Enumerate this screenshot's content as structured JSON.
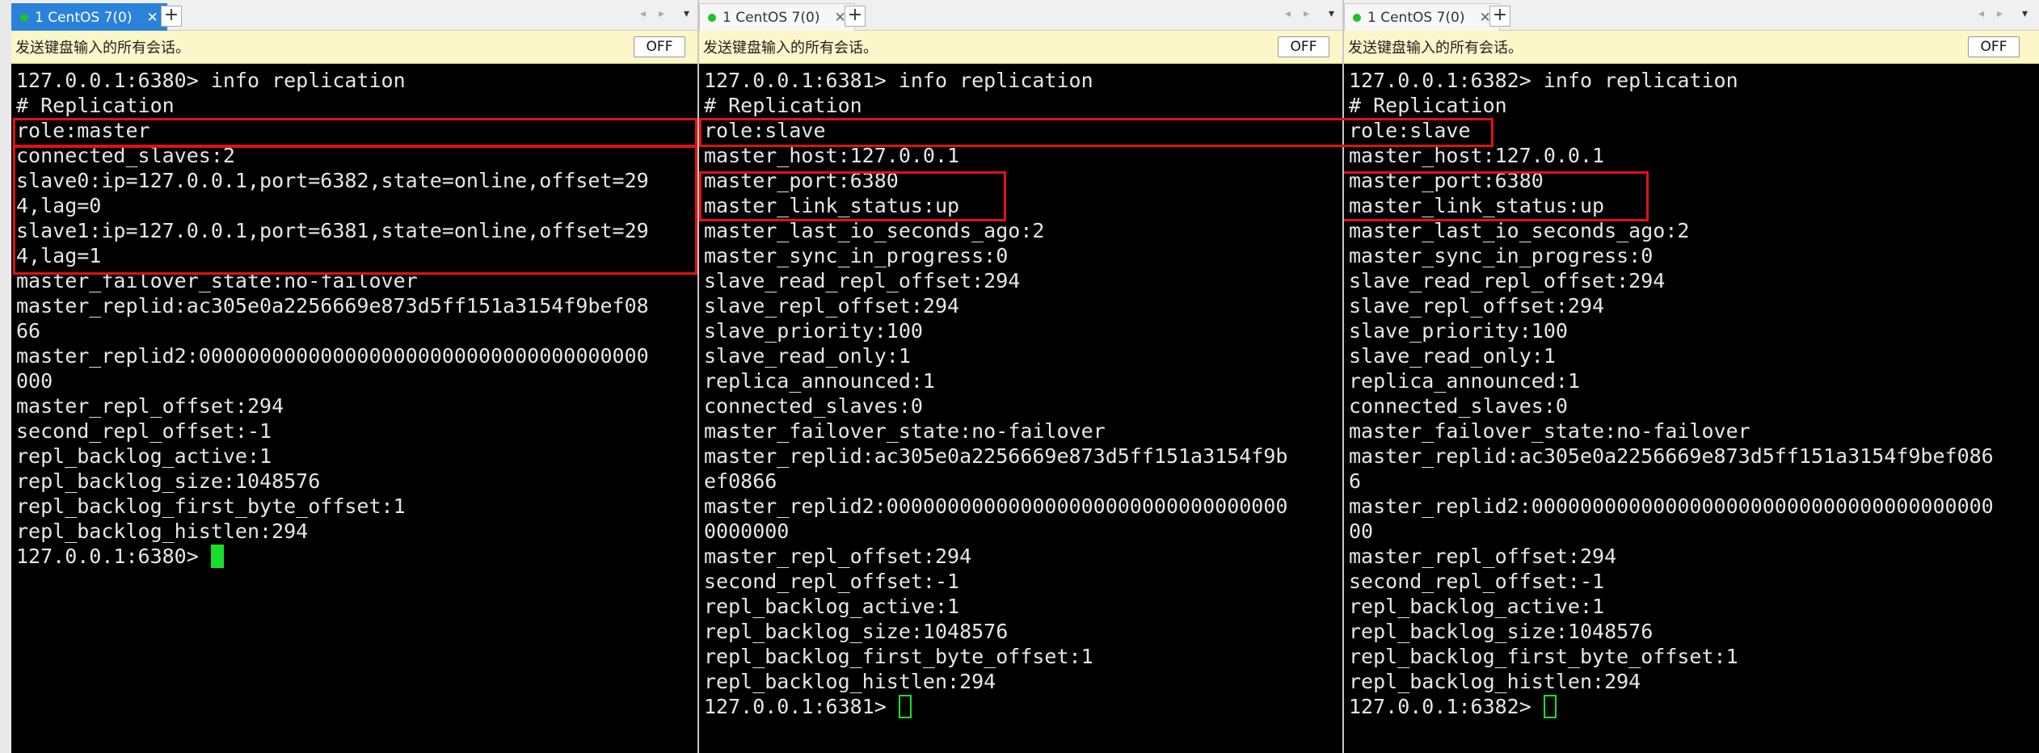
{
  "panes": [
    {
      "tab_label": "1 CentOS 7(0)",
      "send_bar_text": "发送键盘输入的所有会话。",
      "off_button": "OFF",
      "lines": [
        "127.0.0.1:6380> info replication",
        "# Replication",
        "role:master",
        "connected_slaves:2",
        "slave0:ip=127.0.0.1,port=6382,state=online,offset=29",
        "4,lag=0",
        "slave1:ip=127.0.0.1,port=6381,state=online,offset=29",
        "4,lag=1",
        "master_failover_state:no-failover",
        "master_replid:ac305e0a2256669e873d5ff151a3154f9bef08",
        "66",
        "master_replid2:0000000000000000000000000000000000000",
        "000",
        "master_repl_offset:294",
        "second_repl_offset:-1",
        "repl_backlog_active:1",
        "repl_backlog_size:1048576",
        "repl_backlog_first_byte_offset:1",
        "repl_backlog_histlen:294",
        "127.0.0.1:6380> "
      ]
    },
    {
      "tab_label": "1 CentOS 7(0)",
      "send_bar_text": "发送键盘输入的所有会话。",
      "off_button": "OFF",
      "lines": [
        "127.0.0.1:6381> info replication",
        "# Replication",
        "role:slave",
        "master_host:127.0.0.1",
        "master_port:6380",
        "master_link_status:up",
        "master_last_io_seconds_ago:2",
        "master_sync_in_progress:0",
        "slave_read_repl_offset:294",
        "slave_repl_offset:294",
        "slave_priority:100",
        "slave_read_only:1",
        "replica_announced:1",
        "connected_slaves:0",
        "master_failover_state:no-failover",
        "master_replid:ac305e0a2256669e873d5ff151a3154f9b",
        "ef0866",
        "master_replid2:000000000000000000000000000000000",
        "0000000",
        "master_repl_offset:294",
        "second_repl_offset:-1",
        "repl_backlog_active:1",
        "repl_backlog_size:1048576",
        "repl_backlog_first_byte_offset:1",
        "repl_backlog_histlen:294",
        "127.0.0.1:6381> "
      ]
    },
    {
      "tab_label": "1 CentOS 7(0)",
      "send_bar_text": "发送键盘输入的所有会话。",
      "off_button": "OFF",
      "lines": [
        "127.0.0.1:6382> info replication",
        "# Replication",
        "role:slave",
        "master_host:127.0.0.1",
        "master_port:6380",
        "master_link_status:up",
        "master_last_io_seconds_ago:2",
        "master_sync_in_progress:0",
        "slave_read_repl_offset:294",
        "slave_repl_offset:294",
        "slave_priority:100",
        "slave_read_only:1",
        "replica_announced:1",
        "connected_slaves:0",
        "master_failover_state:no-failover",
        "master_replid:ac305e0a2256669e873d5ff151a3154f9bef086",
        "6",
        "master_replid2:00000000000000000000000000000000000000",
        "00",
        "master_repl_offset:294",
        "second_repl_offset:-1",
        "repl_backlog_active:1",
        "repl_backlog_size:1048576",
        "repl_backlog_first_byte_offset:1",
        "repl_backlog_histlen:294",
        "127.0.0.1:6382> "
      ]
    }
  ],
  "colors": {
    "terminal_bg": "#000000",
    "terminal_fg": "#e6e6e6",
    "cursor": "#18e02a",
    "highlight_box": "#e01212",
    "active_tab": "#2a82da",
    "session_dot": "#22c02a",
    "send_bar_bg": "#fcf6c8"
  },
  "icons": [
    "close-icon",
    "add-tab-icon",
    "prev-arrow-icon",
    "next-arrow-icon",
    "tab-menu-icon",
    "session-status-icon"
  ]
}
